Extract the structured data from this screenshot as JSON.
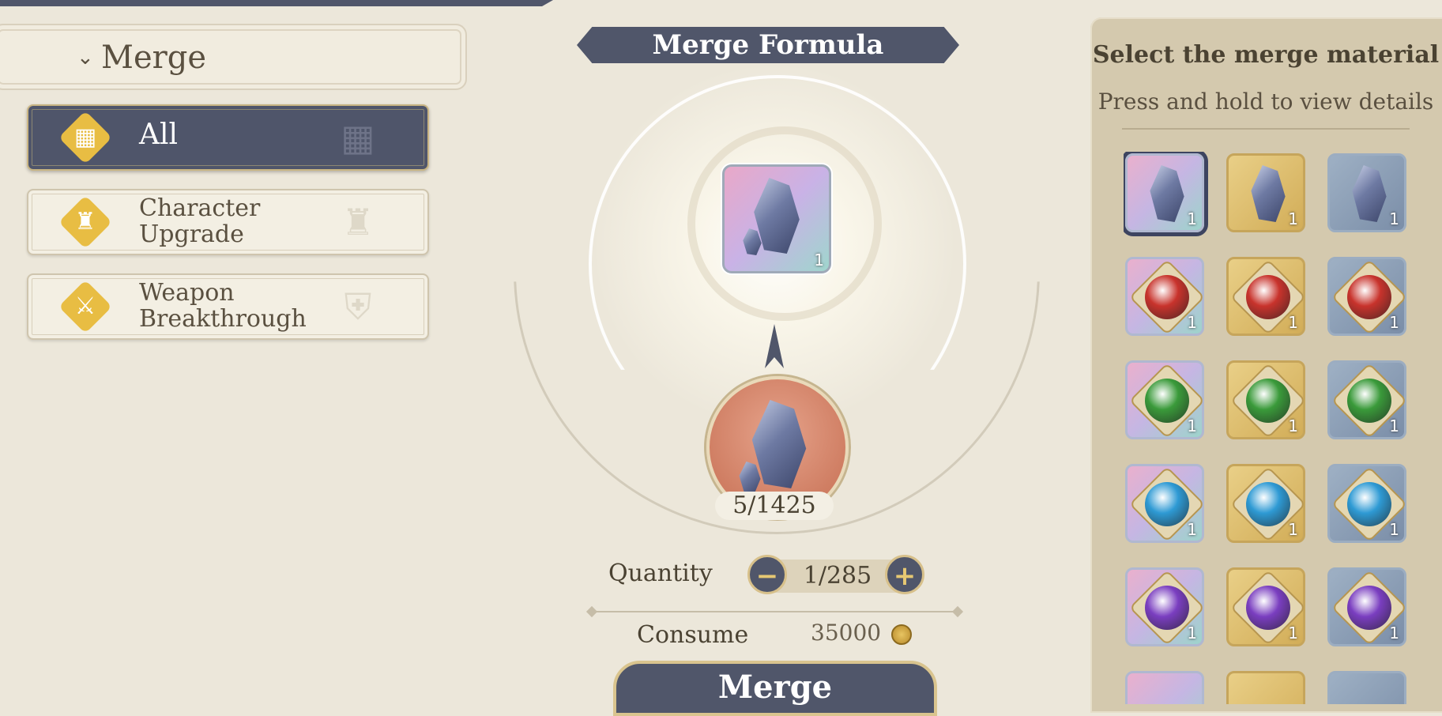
{
  "sidebar": {
    "header": {
      "label": "Merge",
      "chevron_icon": "chevron-down-icon"
    },
    "categories": [
      {
        "label": "All",
        "icon": "grid-icon",
        "active": true
      },
      {
        "label": "Character Upgrade",
        "label_line1": "Character",
        "label_line2": "Upgrade",
        "icon": "helmet-icon",
        "active": false
      },
      {
        "label": "Weapon Breakthrough",
        "label_line1": "Weapon",
        "label_line2": "Breakthrough",
        "icon": "sword-shield-icon",
        "active": false
      }
    ]
  },
  "formula": {
    "title": "Merge Formula",
    "result": {
      "item": "crystal",
      "count": "1"
    },
    "source": {
      "item": "crystal",
      "stock": "5/1425"
    },
    "quantity_label": "Quantity",
    "quantity_value": "1/285",
    "minus_symbol": "−",
    "plus_symbol": "+",
    "consume_label": "Consume",
    "consume_value": "35000",
    "currency_icon": "gold-coin-icon",
    "merge_button": "Merge"
  },
  "materials": {
    "title": "Select the merge material",
    "subtitle": "Press and hold to view details",
    "rows": [
      [
        {
          "item": "crystal",
          "rarity": "pink",
          "count": "1",
          "selected": true
        },
        {
          "item": "crystal",
          "rarity": "gold",
          "count": "1",
          "selected": false
        },
        {
          "item": "crystal",
          "rarity": "blue",
          "count": "1",
          "selected": false
        }
      ],
      [
        {
          "item": "red-gem",
          "rarity": "pink",
          "count": "1",
          "selected": false
        },
        {
          "item": "red-gem",
          "rarity": "gold",
          "count": "1",
          "selected": false
        },
        {
          "item": "red-gem",
          "rarity": "blue",
          "count": "1",
          "selected": false
        }
      ],
      [
        {
          "item": "green-gem",
          "rarity": "pink",
          "count": "1",
          "selected": false
        },
        {
          "item": "green-gem",
          "rarity": "gold",
          "count": "1",
          "selected": false
        },
        {
          "item": "green-gem",
          "rarity": "blue",
          "count": "1",
          "selected": false
        }
      ],
      [
        {
          "item": "blue-gem",
          "rarity": "pink",
          "count": "1",
          "selected": false
        },
        {
          "item": "blue-gem",
          "rarity": "gold",
          "count": "1",
          "selected": false
        },
        {
          "item": "blue-gem",
          "rarity": "blue",
          "count": "1",
          "selected": false
        }
      ],
      [
        {
          "item": "purple-gem",
          "rarity": "pink",
          "count": "1",
          "selected": false
        },
        {
          "item": "purple-gem",
          "rarity": "gold",
          "count": "1",
          "selected": false
        },
        {
          "item": "purple-gem",
          "rarity": "blue",
          "count": "1",
          "selected": false
        }
      ]
    ]
  },
  "colors": {
    "panel_dark": "#50566a",
    "accent_gold": "#e8bd43",
    "background": "#ece7da",
    "gem_red": "#c8332c",
    "gem_green": "#3a9a3a",
    "gem_blue": "#2e9ad4",
    "gem_purple": "#7a3ec0"
  }
}
